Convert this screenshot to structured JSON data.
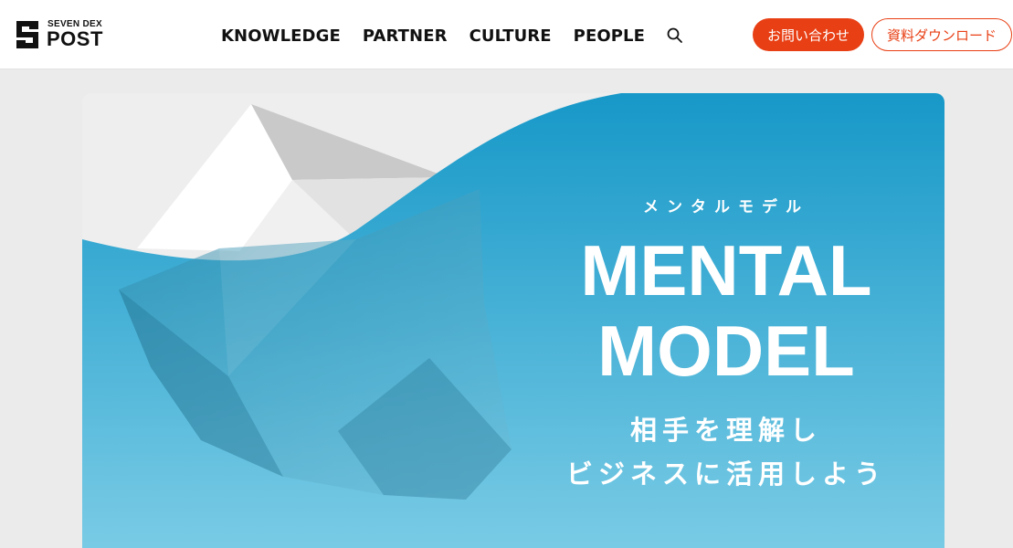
{
  "header": {
    "logo": {
      "small": "SEVEN DEX",
      "big": "POST"
    },
    "nav": [
      "KNOWLEDGE",
      "PARTNER",
      "CULTURE",
      "PEOPLE"
    ],
    "search_icon": "search-icon",
    "contact_label": "お問い合わせ",
    "download_label": "資料ダウンロード"
  },
  "hero": {
    "ruby": "メンタルモデル",
    "title_line1": "MENTAL",
    "title_line2": "MODEL",
    "subtitle_line1": "相手を理解し",
    "subtitle_line2": "ビジネスに活用しよう"
  },
  "colors": {
    "accent": "#e83f14",
    "sea_top": "#1798c8",
    "sea_bottom": "#79cbe5",
    "background": "#ebebeb"
  }
}
